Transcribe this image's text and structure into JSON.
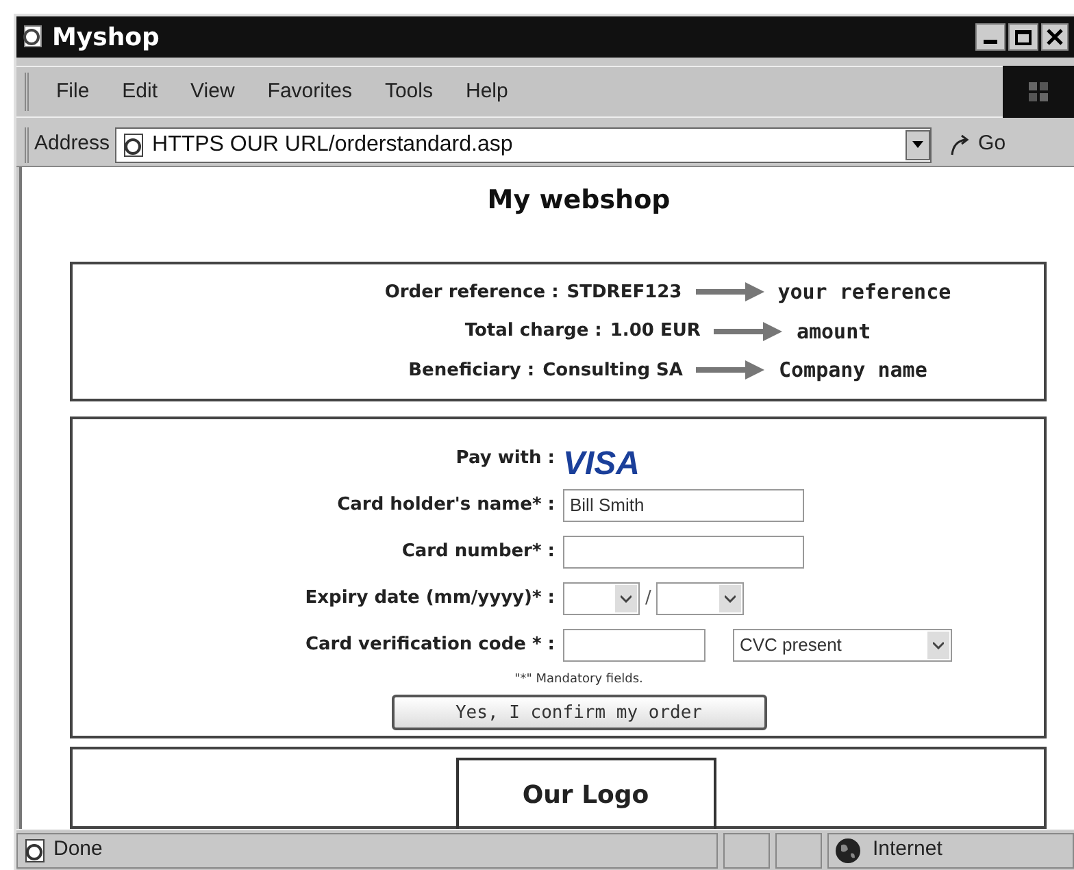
{
  "window": {
    "title": "Myshop"
  },
  "menu": [
    "File",
    "Edit",
    "View",
    "Favorites",
    "Tools",
    "Help"
  ],
  "address_bar": {
    "label": "Address",
    "url": "HTTPS OUR URL/orderstandard.asp",
    "go": "Go"
  },
  "heading": "My webshop",
  "summary": [
    {
      "label": "Order reference :",
      "value": "STDREF123",
      "note": "your reference"
    },
    {
      "label": "Total charge :",
      "value": "1.00 EUR",
      "note": "amount"
    },
    {
      "label": "Beneficiary :",
      "value": "Consulting SA",
      "note": "Company name"
    }
  ],
  "payment": {
    "pay_with": "Pay with :",
    "card_brand": "VISA",
    "fields": [
      {
        "kind": "text",
        "label": "Card holder's name* :",
        "value": "Bill Smith"
      },
      {
        "kind": "text",
        "label": "Card number* :"
      },
      {
        "kind": "expiry",
        "label": "Expiry date (mm/yyyy)* :",
        "separator": "/"
      },
      {
        "kind": "cvc",
        "label": "Card verification code * :",
        "option": "CVC present"
      }
    ],
    "note": "\"*\" Mandatory fields.",
    "button": "Yes, I confirm my order"
  },
  "logo_box": "Our Logo",
  "status_bar": {
    "text": "Done",
    "zone": "Internet"
  }
}
